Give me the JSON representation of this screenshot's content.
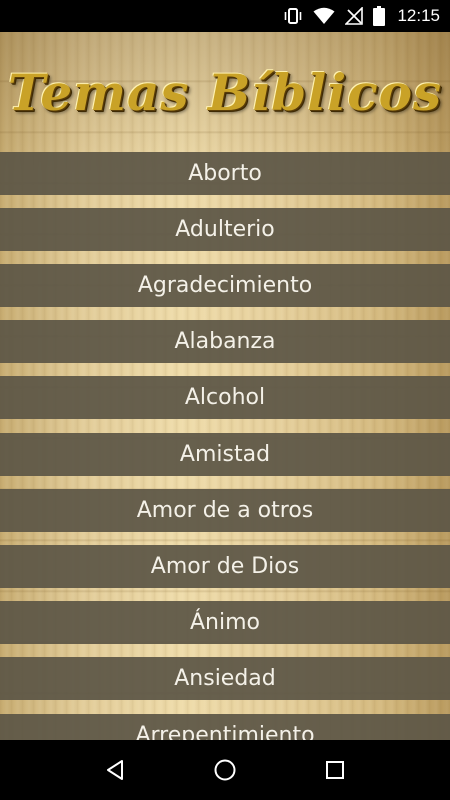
{
  "status_bar": {
    "time": "12:15"
  },
  "header": {
    "title": "Temas Bíblicos"
  },
  "topics": [
    "Aborto",
    "Adulterio",
    "Agradecimiento",
    "Alabanza",
    "Alcohol",
    "Amistad",
    "Amor de a otros",
    "Amor de Dios",
    "Ánimo",
    "Ansiedad",
    "Arrepentimiento"
  ],
  "nav_bar": {
    "back": "back-icon",
    "home": "home-icon",
    "recents": "recents-icon"
  }
}
